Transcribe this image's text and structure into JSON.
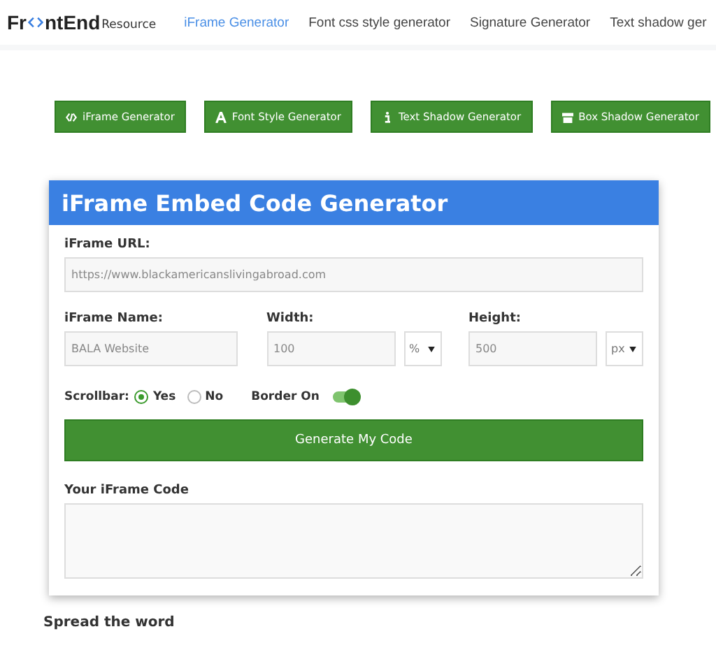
{
  "logo": {
    "part_1": "Fr",
    "part_2": "ntEnd",
    "suffix": "Resource"
  },
  "nav": [
    {
      "label": "iFrame Generator",
      "selected": true
    },
    {
      "label": "Font css style generator",
      "selected": false
    },
    {
      "label": "Signature Generator",
      "selected": false
    },
    {
      "label": "Text shadow ger",
      "selected": false
    }
  ],
  "tool_buttons": [
    {
      "label": "iFrame Generator",
      "kind": "code"
    },
    {
      "label": "Font Style Generator",
      "kind": "font"
    },
    {
      "label": "Text Shadow Generator",
      "kind": "info"
    },
    {
      "label": "Box Shadow Generator",
      "kind": "box"
    }
  ],
  "card": {
    "title": "iFrame Embed Code Generator",
    "url": {
      "label": "iFrame URL:",
      "placeholder": "https://www.blackamericanslivingabroad.com"
    },
    "name": {
      "label": "iFrame Name:",
      "placeholder": "BALA Website"
    },
    "width": {
      "label": "Width:",
      "placeholder": "100",
      "unit": "%"
    },
    "height": {
      "label": "Height:",
      "placeholder": "500",
      "unit": "px"
    },
    "scrollbar": {
      "label": "Scrollbar:",
      "options": [
        {
          "label": "Yes",
          "selected": true
        },
        {
          "label": "No",
          "selected": false
        }
      ]
    },
    "border": {
      "label": "Border On",
      "on": true
    },
    "generate_button": "Generate My Code",
    "code_label": "Your iFrame Code"
  },
  "footer_heading": "Spread the word"
}
